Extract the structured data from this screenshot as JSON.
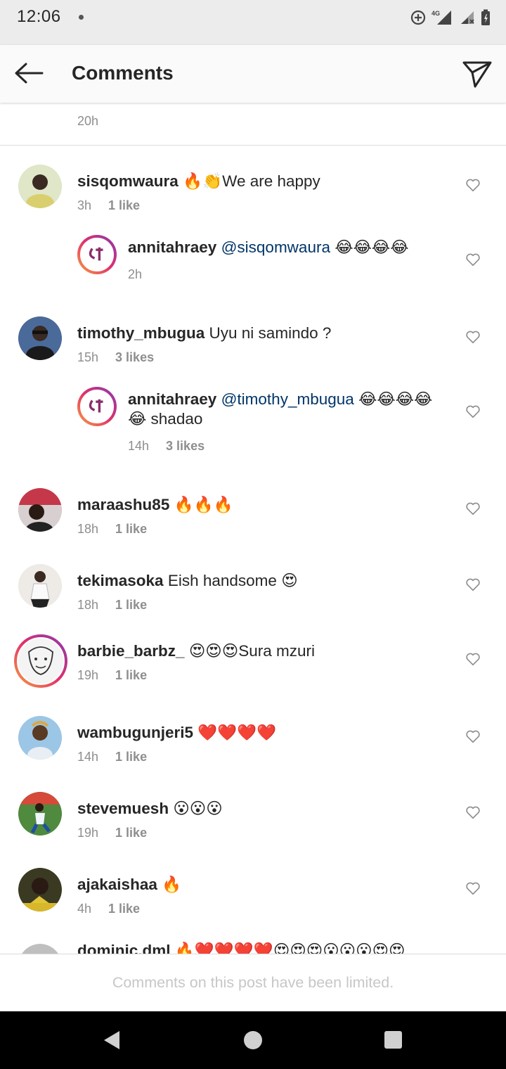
{
  "status_bar": {
    "time": "12:06",
    "network": "4G"
  },
  "header": {
    "title": "Comments"
  },
  "caption": {
    "timestamp": "20h"
  },
  "comments": [
    {
      "username": "sisqomwaura",
      "text": "🔥👏We are happy",
      "time": "3h",
      "likes": "1 like",
      "avatar_color": "#c9d8b6"
    },
    {
      "username": "annitahraey",
      "mention": "@sisqomwaura",
      "text": " 😂😂😂😂",
      "time": "2h",
      "likes": "",
      "is_reply": true
    },
    {
      "username": "timothy_mbugua",
      "text": "Uyu ni samindo ?",
      "time": "15h",
      "likes": "3 likes",
      "avatar_color": "#2b3a5a"
    },
    {
      "username": "annitahraey",
      "mention": "@timothy_mbugua",
      "text": " 😂😂😂😂 😂 shadao",
      "time": "14h",
      "likes": "3 likes",
      "is_reply": true
    },
    {
      "username": "maraashu85",
      "text": "🔥🔥🔥",
      "time": "18h",
      "likes": "1 like",
      "avatar_color": "#c44a5a"
    },
    {
      "username": "tekimasoka",
      "text": "Eish handsome 😍",
      "time": "18h",
      "likes": "1 like",
      "avatar_color": "#e7e2dc"
    },
    {
      "username": "barbie_barbz_",
      "text": "😍😍😍Sura mzuri",
      "time": "19h",
      "likes": "1 like",
      "avatar_color": "#f3f3f3",
      "story_ring": true
    },
    {
      "username": "wambugunjeri5",
      "text": "❤️❤️❤️❤️",
      "time": "14h",
      "likes": "1 like",
      "avatar_color": "#7fb3d9"
    },
    {
      "username": "stevemuesh",
      "text": "😮😮😮",
      "time": "19h",
      "likes": "1 like",
      "avatar_color": "#3f7a3a"
    },
    {
      "username": "ajakaishaa",
      "text": "🔥",
      "time": "4h",
      "likes": "1 like",
      "avatar_color": "#6a5a2a"
    },
    {
      "username": "dominic.dml",
      "text": "🔥❤️❤️❤️❤️😍😍😍😮😮😮😍😍",
      "time": "",
      "likes": "",
      "avatar_color": "#bfbfbf"
    }
  ],
  "footer": {
    "notice": "Comments on this post have been limited."
  },
  "colors": {
    "ring_start": "#f9a03f",
    "ring_mid": "#e1306c",
    "ring_end": "#833ab4",
    "meta": "#8e8e8e",
    "mention": "#003569"
  },
  "icons": {
    "back": "arrow-left-icon",
    "share": "paper-plane-icon",
    "like": "heart-outline-icon"
  }
}
